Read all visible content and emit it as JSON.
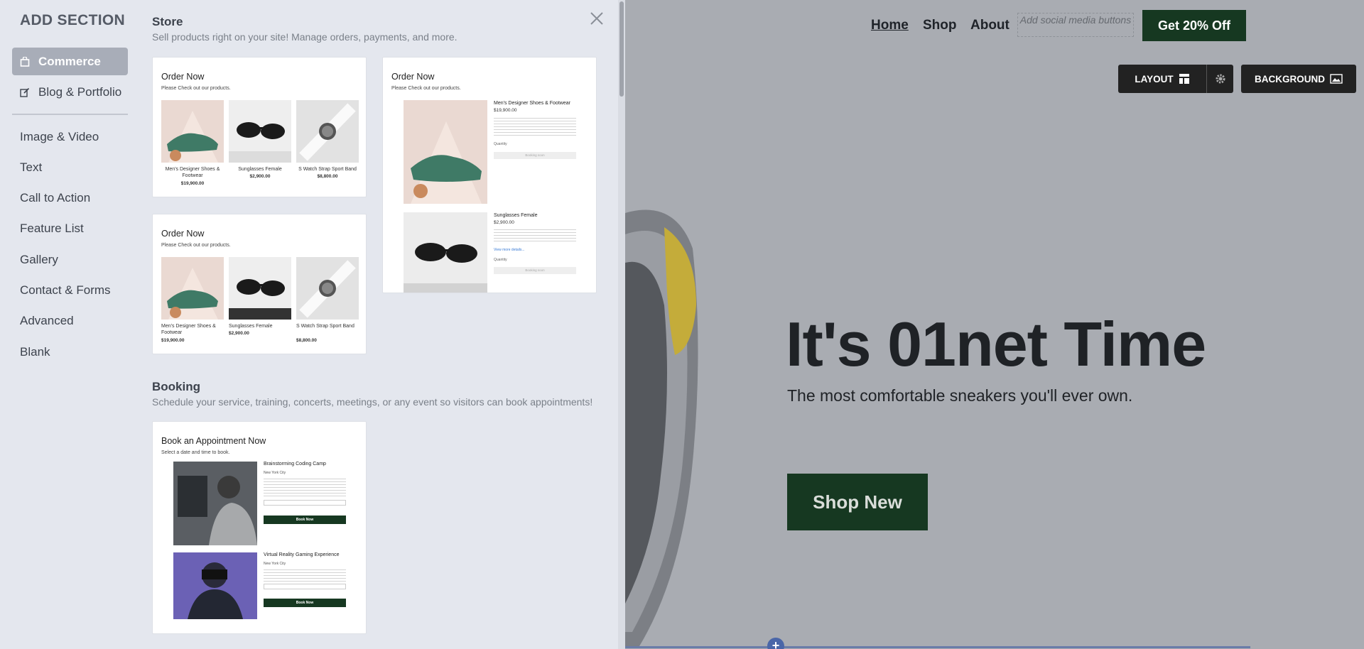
{
  "panel": {
    "title": "ADD SECTION",
    "nav": [
      {
        "label": "Commerce",
        "active": true,
        "icon": "shopping-bag-icon"
      },
      {
        "label": "Blog & Portfolio",
        "active": false,
        "icon": "edit-icon"
      }
    ],
    "categories": [
      "Image & Video",
      "Text",
      "Call to Action",
      "Feature List",
      "Gallery",
      "Contact & Forms",
      "Advanced",
      "Blank"
    ],
    "close_icon": "close-icon"
  },
  "store": {
    "title": "Store",
    "description": "Sell products right on your site! Manage orders, payments, and more.",
    "card_title": "Order Now",
    "card_subtitle": "Please Check out our products.",
    "products": [
      {
        "name": "Men's Designer Shoes & Footwear",
        "price": "$19,900.00"
      },
      {
        "name": "Sunglasses Female",
        "price": "$2,900.00"
      },
      {
        "name": "S Watch Strap Sport Band",
        "price": "$8,800.00"
      }
    ],
    "detail": {
      "product1_name": "Men's Designer Shoes & Footwear",
      "product1_price": "$19,900.00",
      "product2_name": "Sunglasses Female",
      "product2_price": "$2,900.00",
      "quantity_label": "Quantity",
      "view_more": "View more details...",
      "button": "Booking soon"
    }
  },
  "booking": {
    "title": "Booking",
    "description": "Schedule your service, training, concerts, meetings, or any event so visitors can book appointments!",
    "card_title": "Book an Appointment Now",
    "card_subtitle": "Select a date and time to book.",
    "events": [
      {
        "name": "Brainstorming Coding Camp",
        "location": "New York City",
        "button": "Book Now"
      },
      {
        "name": "Virtual Reality Gaming Experience",
        "location": "New York City",
        "button": "Book Now"
      }
    ]
  },
  "preview": {
    "nav": [
      "Home",
      "Shop",
      "About"
    ],
    "social_placeholder": "Add social media buttons",
    "promo": "Get 20% Off",
    "layout_label": "LAYOUT",
    "background_label": "BACKGROUND",
    "headline": "It's 01net Time",
    "subheadline": "The most comfortable sneakers you'll ever own.",
    "cta": "Shop New",
    "add_section_symbol": "+"
  },
  "colors": {
    "brand_green": "#163821",
    "panel_bg": "#e4e7ee",
    "active_nav": "#a8adb8",
    "accent_blue": "#4a66a8"
  }
}
